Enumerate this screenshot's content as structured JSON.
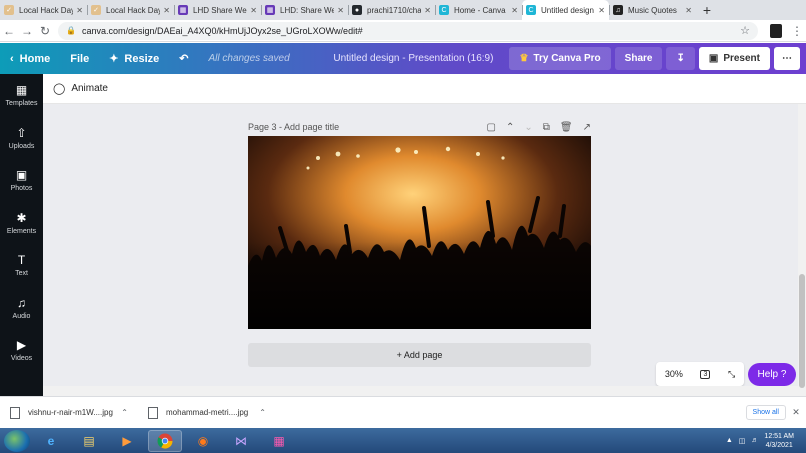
{
  "browser": {
    "tabs": [
      {
        "title": "Local Hack Day",
        "icon": "hack-icon",
        "color": "#e2c08d",
        "active": false
      },
      {
        "title": "Local Hack Day",
        "icon": "hack-icon",
        "color": "#e2c08d",
        "active": false
      },
      {
        "title": "LHD Share We",
        "icon": "form-icon",
        "color": "#673ab7",
        "active": false
      },
      {
        "title": "LHD: Share We",
        "icon": "form-icon",
        "color": "#673ab7",
        "active": false
      },
      {
        "title": "prachi1710/cha",
        "icon": "github-icon",
        "color": "#24292e",
        "active": false
      },
      {
        "title": "Home - Canva",
        "icon": "canva-icon",
        "color": "#1fb6d6",
        "active": false
      },
      {
        "title": "Untitled design",
        "icon": "canva-icon",
        "color": "#1fb6d6",
        "active": true
      },
      {
        "title": "Music Quotes",
        "icon": "music-icon",
        "color": "#222222",
        "active": false
      }
    ],
    "url": "canva.com/design/DAEai_A4XQ0/kHmUjJOyx2se_UGroLXOWw/edit#"
  },
  "toolbar": {
    "home": "Home",
    "file": "File",
    "resize": "Resize",
    "saved_status": "All changes saved",
    "doc_title": "Untitled design - Presentation (16:9)",
    "try_pro": "Try Canva Pro",
    "share": "Share",
    "present": "Present"
  },
  "sidebar": {
    "items": [
      {
        "label": "Templates",
        "icon": "templates-icon"
      },
      {
        "label": "Uploads",
        "icon": "upload-icon"
      },
      {
        "label": "Photos",
        "icon": "photos-icon"
      },
      {
        "label": "Elements",
        "icon": "elements-icon"
      },
      {
        "label": "Text",
        "icon": "text-icon"
      },
      {
        "label": "Audio",
        "icon": "audio-icon"
      },
      {
        "label": "Videos",
        "icon": "video-icon"
      }
    ]
  },
  "subbar": {
    "animate": "Animate"
  },
  "page": {
    "header": "Page 3 - Add page title",
    "add_page": "+ Add page"
  },
  "zoom": {
    "level": "30%",
    "page_count": "3"
  },
  "help": {
    "label": "Help ?"
  },
  "downloads": {
    "items": [
      {
        "name": "vishnu-r-nair-m1W....jpg"
      },
      {
        "name": "mohammad-metri....jpg"
      }
    ],
    "show_all": "Show all"
  },
  "taskbar": {
    "time": "12:51 AM",
    "date": "4/3/2021"
  },
  "colors": {
    "purple_accent": "#7d2ae8",
    "toolbar_start": "#0d9cb8",
    "toolbar_end": "#6d3fd0"
  }
}
